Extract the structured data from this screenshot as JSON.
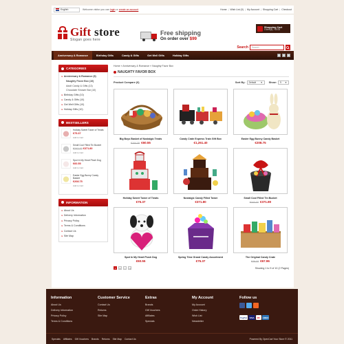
{
  "topbar": {
    "language": "English",
    "welcome_prefix": "Welcome visitor you can",
    "login": "login",
    "or": "or",
    "create_account": "create an account",
    "links": [
      "Home",
      "Wish List (0)",
      "My Account",
      "Shopping Cart",
      "Checkout"
    ]
  },
  "header": {
    "logo_title_part1": "Gift",
    "logo_title_part2": "store",
    "logo_slogan": "Slogan goes here",
    "freeship_title": "Free shipping",
    "freeship_sub_prefix": "On order over",
    "freeship_amount": "$99",
    "cart_title": "Shopping Cart",
    "cart_summary": "0 item(s) - €0.00",
    "search_label": "Search",
    "search_placeholder": "Search"
  },
  "nav": {
    "items": [
      "Anniversary & Romance",
      "Birthday Gifts",
      "Candy & Gifts",
      "Get Well Gifts",
      "Holiday Gifts"
    ]
  },
  "categories": {
    "title": "CATEGORIES",
    "items": [
      {
        "label": "Anniversary & Romance (9)",
        "active": true
      },
      {
        "label": "Naughty Favor Box (10)",
        "sub": true,
        "bold": true
      },
      {
        "label": "Adult Candy & Gifts (13)",
        "sub": true
      },
      {
        "label": "Chocolate Shower Bar (10)",
        "sub": true
      },
      {
        "label": "Birthday Gifts (10)"
      },
      {
        "label": "Candy & Gifts (10)"
      },
      {
        "label": "Get Well Gifts (10)"
      },
      {
        "label": "Holiday Gifts (10)"
      }
    ]
  },
  "bestsellers": {
    "title": "BESTSELLERS",
    "add_label": "Add to Cart",
    "items": [
      {
        "name": "Holiday Sweet Tower of Treats",
        "price": "€75.37",
        "old": ""
      },
      {
        "name": "Small Cool Filled Tin Bucket",
        "price": "€371.80",
        "old": "€242.32"
      },
      {
        "name": "Spot In My Heart Plush Dog",
        "price": "€60.55",
        "old": ""
      },
      {
        "name": "Easter Egg Bunny Candy Basket",
        "price": "€208.75",
        "old": ""
      }
    ]
  },
  "information": {
    "title": "INFORMATION",
    "items": [
      "About Us",
      "Delivery Information",
      "Privacy Policy",
      "Terms & Conditions",
      "Contact Us",
      "Site Map"
    ]
  },
  "main": {
    "breadcrumb": "Home » Anniversary & Romance » Naughty Favor Box",
    "title": "NAUGHTY FAVOR BOX",
    "compare": "Product Compare (0)",
    "sort_label": "Sort By:",
    "sort_value": "Default",
    "show_label": "Show:",
    "show_value": "9",
    "showing": "Showing 1 to 9 of 10 (2 Pages)",
    "pages": [
      "1",
      "2",
      ">",
      ">|"
    ]
  },
  "products": [
    {
      "name": "Big Boys Basket of Nostalgic Treats",
      "old": "€104.35",
      "price": "€60.55",
      "img": "basket"
    },
    {
      "name": "Candy Crate Express Train Gift Box",
      "old": "",
      "price": "€1,261.40",
      "img": "train"
    },
    {
      "name": "Easter Egg Bunny Candy Basket",
      "old": "",
      "price": "€208.75",
      "img": "bunny"
    },
    {
      "name": "Holiday Sweet Tower of Treats",
      "old": "",
      "price": "€75.37",
      "img": "tower"
    },
    {
      "name": "Nostalgic Candy Filled Tower",
      "old": "",
      "price": "€371.80",
      "img": "tower2"
    },
    {
      "name": "Small Cool Filled Tin Bucket",
      "old": "€242.32",
      "price": "€371.80",
      "img": "bucket"
    },
    {
      "name": "Spot In My Heart Plush Dog",
      "old": "",
      "price": "€60.55",
      "img": "dog"
    },
    {
      "name": "Spring Time Grand Candy Assortment",
      "old": "",
      "price": "€75.37",
      "img": "box"
    },
    {
      "name": "The Original Candy Crate",
      "old": "€76.33",
      "price": "€67.96",
      "img": "crate"
    }
  ],
  "footer": {
    "columns": [
      {
        "title": "Information",
        "links": [
          "About Us",
          "Delivery Information",
          "Privacy Policy",
          "Terms & Conditions"
        ]
      },
      {
        "title": "Customer Service",
        "links": [
          "Contact Us",
          "Returns",
          "Site Map"
        ]
      },
      {
        "title": "Extras",
        "links": [
          "Brands",
          "Gift Vouchers",
          "Affiliates",
          "Specials"
        ]
      },
      {
        "title": "My Account",
        "links": [
          "My Account",
          "Order History",
          "Wish List",
          "Newsletter"
        ]
      }
    ],
    "follow_title": "Follow us",
    "payments": [
      "PayPal",
      "VISA",
      "MC",
      "AMEX"
    ],
    "bottom_links": [
      "Specials",
      "Affiliates",
      "Gift Vouchers",
      "Brands",
      "Returns",
      "Site Map",
      "Contact Us"
    ],
    "powered": "Powered By OpenCart Your Store © 2011"
  },
  "colors": {
    "accent": "#c81414",
    "dark_brown": "#3a1910",
    "nav_brown": "#4e1f0f"
  }
}
